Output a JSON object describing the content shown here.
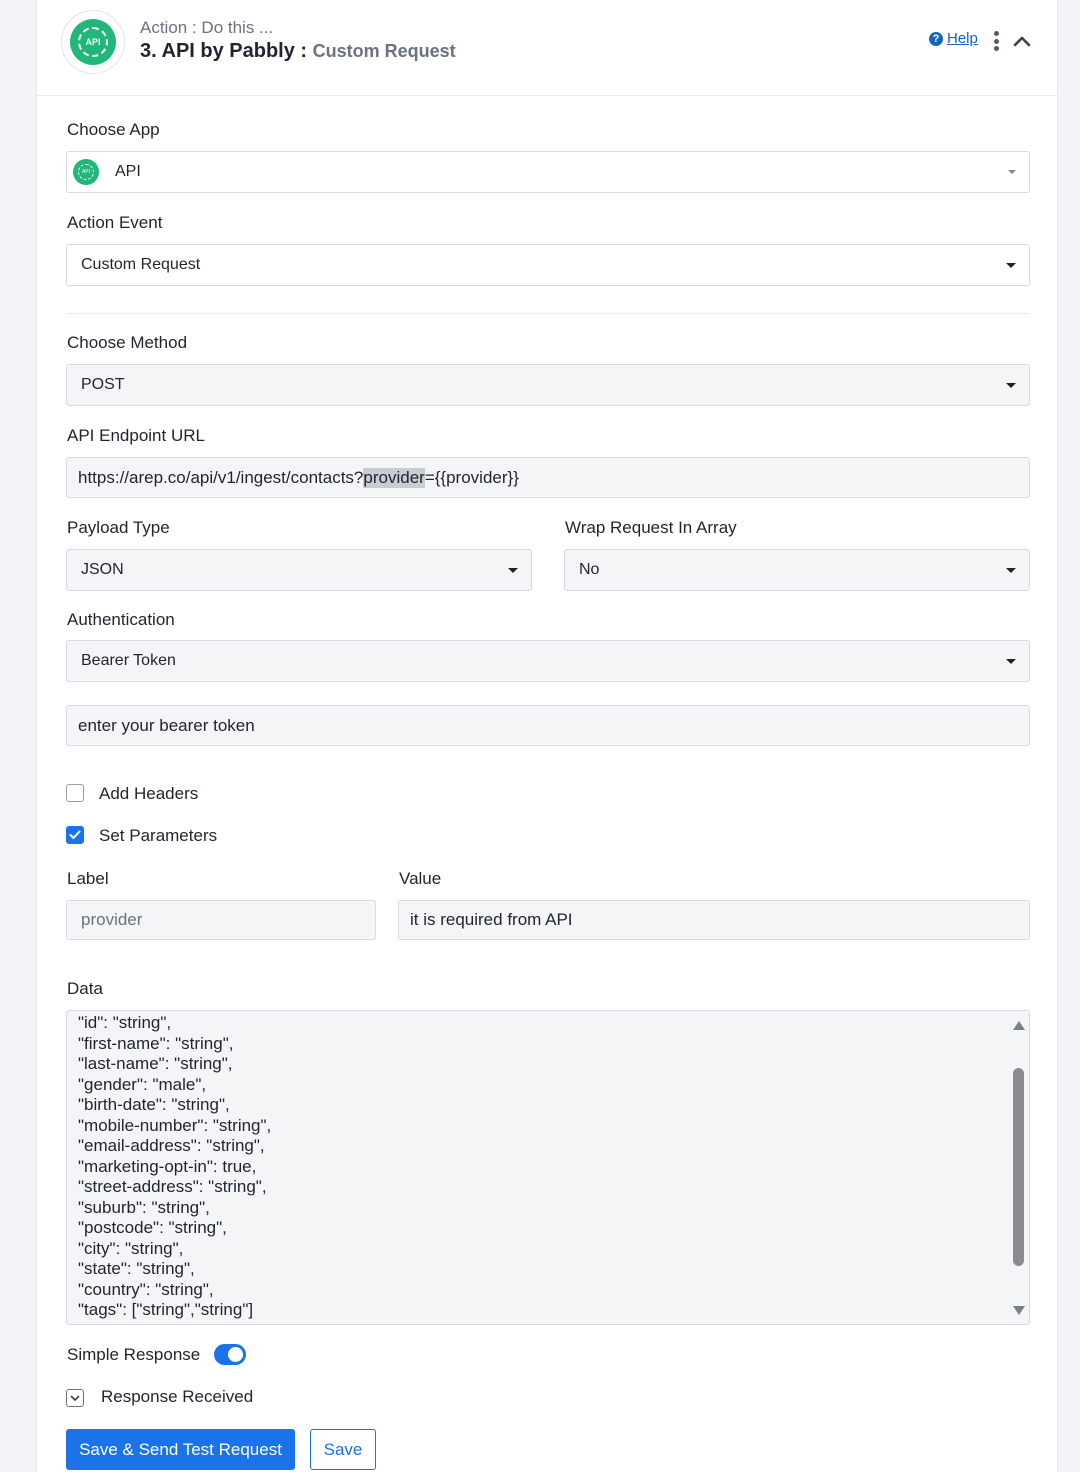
{
  "header": {
    "subtitle": "Action : Do this ...",
    "title": "3. API by Pabbly :",
    "event": "Custom Request",
    "help": "Help",
    "logo_text": "API"
  },
  "choose_app": {
    "label": "Choose App",
    "value": "API"
  },
  "action_event": {
    "label": "Action Event",
    "value": "Custom Request"
  },
  "choose_method": {
    "label": "Choose Method",
    "value": "POST"
  },
  "endpoint": {
    "label": "API Endpoint URL",
    "prefix": "https://arep.co/api/v1/ingest/contacts?",
    "highlight": "provider",
    "suffix": "={{provider}}"
  },
  "payload_type": {
    "label": "Payload Type",
    "value": "JSON"
  },
  "wrap_request": {
    "label": "Wrap Request In Array",
    "value": "No"
  },
  "authentication": {
    "label": "Authentication",
    "value": "Bearer Token"
  },
  "bearer_token": {
    "placeholder": "enter your bearer token"
  },
  "add_headers": {
    "label": "Add Headers",
    "checked": false
  },
  "set_parameters": {
    "label": "Set Parameters",
    "checked": true
  },
  "parameters": {
    "label_header": "Label",
    "value_header": "Value",
    "label_value": "provider",
    "value_value": "it is required from API"
  },
  "data": {
    "label": "Data",
    "content": "\"id\": \"string\",\n\"first-name\": \"string\",\n\"last-name\": \"string\",\n\"gender\": \"male\",\n\"birth-date\": \"string\",\n\"mobile-number\": \"string\",\n\"email-address\": \"string\",\n\"marketing-opt-in\": true,\n\"street-address\": \"string\",\n\"suburb\": \"string\",\n\"postcode\": \"string\",\n\"city\": \"string\",\n\"state\": \"string\",\n\"country\": \"string\",\n\"tags\": [\"string\",\"string\"]"
  },
  "simple_response": {
    "label": "Simple Response",
    "enabled": true
  },
  "response_received": {
    "label": "Response Received"
  },
  "buttons": {
    "save_send": "Save & Send Test Request",
    "save": "Save"
  },
  "colors": {
    "primary": "#1a73e8",
    "brand_green": "#21b67a",
    "link": "#1565c0"
  }
}
